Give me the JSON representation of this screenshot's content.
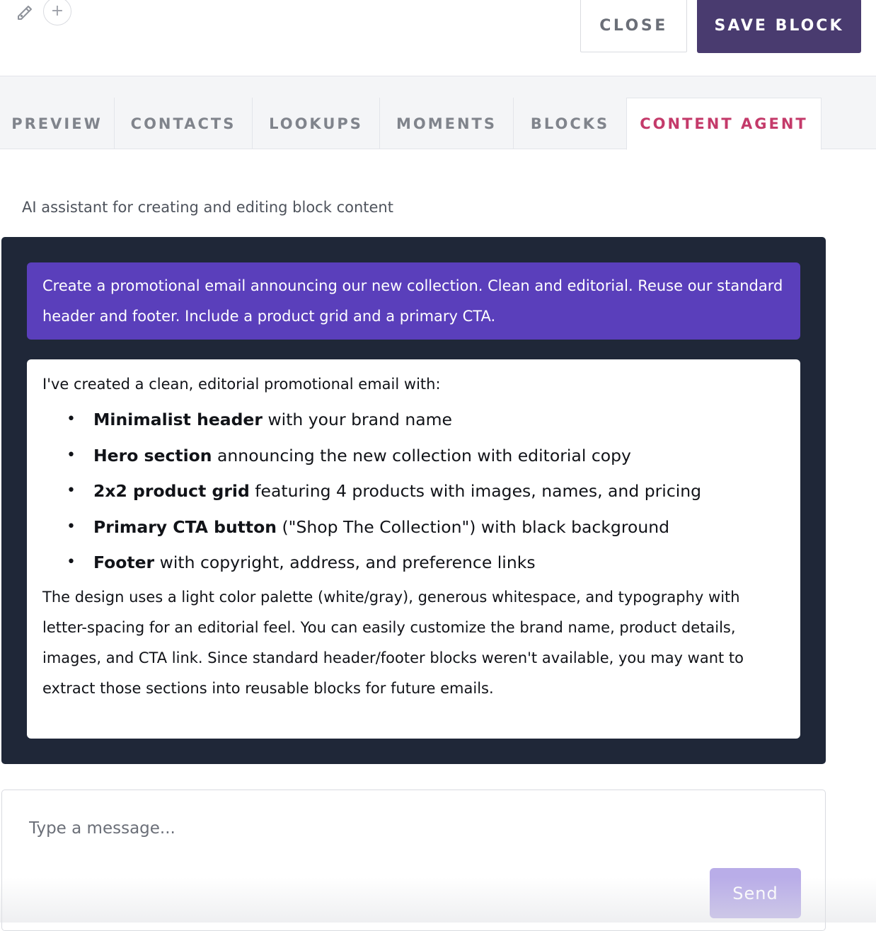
{
  "toolbar": {
    "close_label": "CLOSE",
    "save_label": "SAVE BLOCK",
    "plus_glyph": "+"
  },
  "tabs": [
    {
      "label": "PREVIEW"
    },
    {
      "label": "CONTACTS"
    },
    {
      "label": "LOOKUPS"
    },
    {
      "label": "MOMENTS"
    },
    {
      "label": "BLOCKS"
    },
    {
      "label": "CONTENT AGENT",
      "active": true
    }
  ],
  "content": {
    "subtitle": "AI assistant for creating and editing block content"
  },
  "chat": {
    "user_message": "Create a promotional email announcing our new collection. Clean and editorial. Reuse our standard header and footer. Include a product grid and a primary CTA.",
    "agent_intro": "I've created a clean, editorial promotional email with:",
    "agent_items": [
      {
        "strong": "Minimalist header",
        "rest": " with your brand name"
      },
      {
        "strong": "Hero section",
        "rest": " announcing the new collection with editorial copy"
      },
      {
        "strong": "2x2 product grid",
        "rest": " featuring 4 products with images, names, and pricing"
      },
      {
        "strong": "Primary CTA button",
        "rest": " (\"Shop The Collection\") with black background"
      },
      {
        "strong": "Footer",
        "rest": " with copyright, address, and preference links"
      }
    ],
    "agent_outro": "The design uses a light color palette (white/gray), generous whitespace, and typography with letter-spacing for an editorial feel. You can easily customize the brand name, product details, images, and CTA link. Since standard header/footer blocks weren't available, you may want to extract those sections into reusable blocks for future emails."
  },
  "composer": {
    "placeholder": "Type a message...",
    "send_label": "Send"
  },
  "colors": {
    "save_button": "#493b6f",
    "active_tab": "#c43a6a",
    "chat_panel": "#1f2738",
    "user_bubble": "#5a3fbb",
    "send_button": "#b9ade8"
  },
  "icons": {
    "edit": "pencil-icon",
    "add": "plus-icon",
    "bullet": "•"
  }
}
